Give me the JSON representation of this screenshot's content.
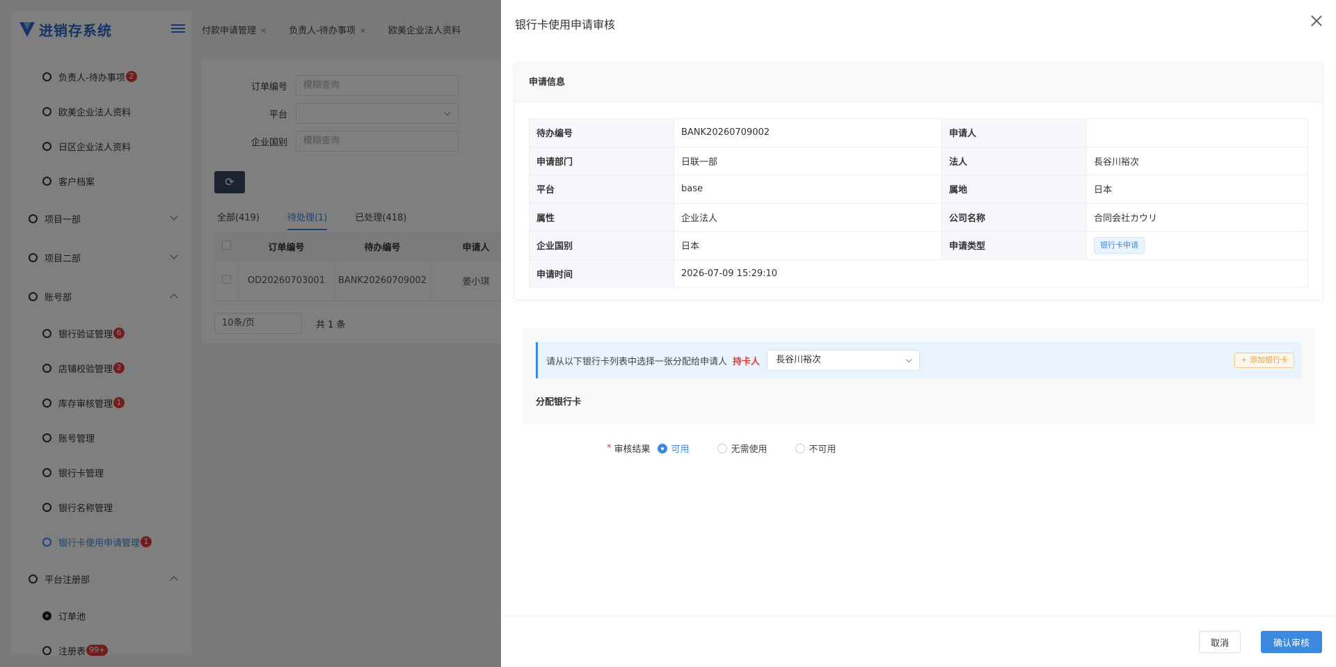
{
  "app": {
    "title": "进销存系统"
  },
  "sidebar": {
    "items": [
      {
        "label": "负责人-待办事项",
        "badge": "2"
      },
      {
        "label": "欧美企业法人资料"
      },
      {
        "label": "日区企业法人资料"
      },
      {
        "label": "客户档案"
      },
      {
        "label": "项目一部"
      },
      {
        "label": "项目二部"
      },
      {
        "label": "账号部"
      },
      {
        "label": "银行验证管理",
        "badge": "6"
      },
      {
        "label": "店铺校验管理",
        "badge": "2"
      },
      {
        "label": "库存审核管理",
        "badge": "1"
      },
      {
        "label": "账号管理"
      },
      {
        "label": "银行卡管理"
      },
      {
        "label": "银行名称管理"
      },
      {
        "label": "银行卡使用申请管理",
        "badge": "1"
      },
      {
        "label": "平台注册部"
      },
      {
        "label": "订单池"
      },
      {
        "label": "注册表",
        "badge": "99+"
      }
    ]
  },
  "tabs": [
    {
      "label": "付款申请管理"
    },
    {
      "label": "负责人-待办事项"
    },
    {
      "label": "欧美企业法人资料"
    }
  ],
  "filters": {
    "order_no_label": "订单编号",
    "order_no_placeholder": "模糊查询",
    "platform_label": "平台",
    "country_label": "企业国别",
    "country_placeholder": "模糊查询"
  },
  "list_tabs": {
    "all": "全部(419)",
    "pending": "待处理(1)",
    "done": "已处理(418)"
  },
  "table": {
    "headers": [
      "订单编号",
      "待办编号",
      "申请人"
    ],
    "rows": [
      [
        "OD20260703001",
        "BANK20260709002",
        "姜小琪"
      ]
    ]
  },
  "pager": {
    "page_size": "10条/页",
    "total": "共 1 条"
  },
  "drawer": {
    "title": "银行卡使用申请审核",
    "info_title": "申请信息",
    "info": {
      "todo_no_label": "待办编号",
      "todo_no": "BANK20260709002",
      "applicant_label": "申请人",
      "applicant": "",
      "dept_label": "申请部门",
      "dept": "日联一部",
      "legal_label": "法人",
      "legal": "長谷川裕次",
      "platform_label": "平台",
      "platform": "base",
      "region_label": "属地",
      "region": "日本",
      "attr_label": "属性",
      "attr": "企业法人",
      "company_label": "公司名称",
      "company": "合同会社カウリ",
      "country_label": "企业国别",
      "country": "日本",
      "type_label": "申请类型",
      "type": "银行卡申请",
      "time_label": "申请时间",
      "time": "2026-07-09 15:29:10"
    },
    "assign": {
      "hint": "请从以下银行卡列表中选择一张分配给申请人",
      "holder_label": "持卡人",
      "holder_value": "長谷川裕次",
      "add_button": "+ 添加银行卡",
      "section_label": "分配银行卡"
    },
    "result": {
      "required_mark": "*",
      "label": "审核结果",
      "options": [
        "可用",
        "无需使用",
        "不可用"
      ],
      "selected": "可用"
    },
    "footer": {
      "cancel": "取消",
      "confirm": "确认审核"
    }
  },
  "colors": {
    "primary": "#3c8ae0",
    "danger": "#e23b3b",
    "warning": "#e6a23c",
    "sidebar_dark": "#3a4660"
  }
}
